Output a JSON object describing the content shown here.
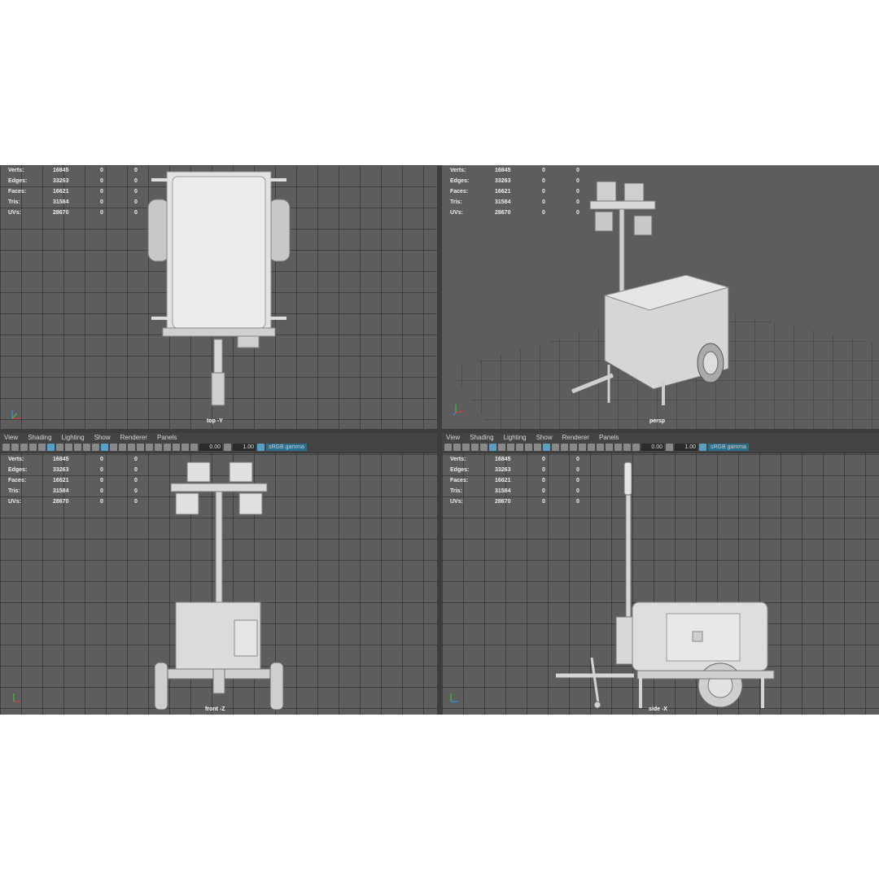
{
  "menu": [
    "View",
    "Shading",
    "Lighting",
    "Show",
    "Renderer",
    "Panels"
  ],
  "toolbar": {
    "exposure": "0.00",
    "gamma": "1.00",
    "colorspace": "sRGB gamma"
  },
  "stats": {
    "labels": [
      "Verts:",
      "Edges:",
      "Faces:",
      "Tris:",
      "UVs:"
    ],
    "values": [
      [
        "16845",
        "0",
        "0"
      ],
      [
        "33263",
        "0",
        "0"
      ],
      [
        "16621",
        "0",
        "0"
      ],
      [
        "31584",
        "0",
        "0"
      ],
      [
        "28670",
        "0",
        "0"
      ]
    ]
  },
  "viewports": {
    "top": "top -Y",
    "persp": "persp",
    "front": "front -Z",
    "side": "side -X"
  },
  "colors": {
    "viewport_bg": "#5d5d5d",
    "model": "#d9d9d9",
    "accent": "#5a9ec4"
  }
}
